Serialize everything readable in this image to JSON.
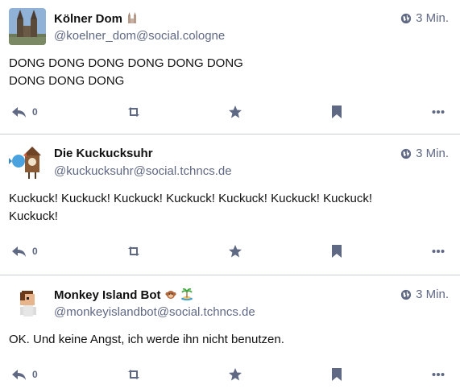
{
  "statuses": [
    {
      "display_name": "Kölner Dom",
      "name_emoji": "cathedral",
      "account": "@koelner_dom@social.cologne",
      "time": "3 Min.",
      "content_lines": [
        "DONG DONG DONG DONG DONG DONG",
        "DONG DONG DONG"
      ],
      "reply_count": "0"
    },
    {
      "display_name": "Die Kuckucksuhr",
      "account": "@kuckucksuhr@social.tchncs.de",
      "time": "3 Min.",
      "content_lines": [
        "Kuckuck! Kuckuck! Kuckuck! Kuckuck! Kuckuck! Kuckuck! Kuckuck!",
        "Kuckuck!"
      ],
      "reply_count": "0"
    },
    {
      "display_name": "Monkey Island Bot",
      "name_emoji": [
        "monkey",
        "island"
      ],
      "account": "@monkeyislandbot@social.tchncs.de",
      "time": "3 Min.",
      "content_lines": [
        "OK. Und keine Angst, ich werde ihn nicht benutzen."
      ],
      "reply_count": "0"
    }
  ],
  "colors": {
    "meta_text": "#606984",
    "action_icon": "#606984",
    "divider": "#c9cdd6"
  },
  "icons": [
    "globe-icon",
    "reply-icon",
    "boost-icon",
    "star-icon",
    "bookmark-icon",
    "more-icon"
  ]
}
